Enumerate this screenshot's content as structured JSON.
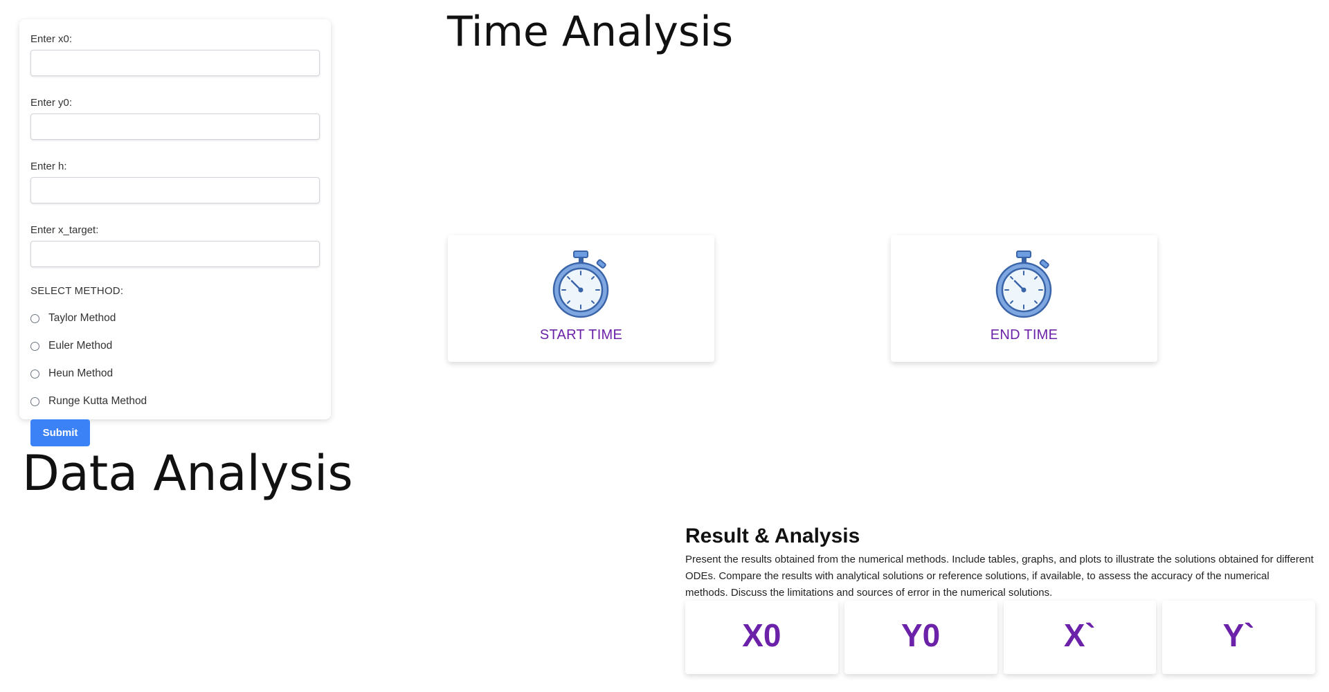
{
  "form": {
    "fields": [
      {
        "label": "Enter x0:",
        "value": "",
        "placeholder": ""
      },
      {
        "label": "Enter y0:",
        "value": "",
        "placeholder": ""
      },
      {
        "label": "Enter h:",
        "value": "",
        "placeholder": ""
      },
      {
        "label": "Enter x_target:",
        "value": "",
        "placeholder": ""
      }
    ],
    "method_heading": "SELECT METHOD:",
    "methods": [
      "Taylor Method",
      "Euler Method",
      "Heun Method",
      "Runge Kutta Method"
    ],
    "submit_label": "Submit"
  },
  "time_analysis": {
    "title": "Time Analysis",
    "start_label": "START TIME",
    "end_label": "END TIME",
    "icon": "stopwatch-icon"
  },
  "data_analysis": {
    "title": "Data Analysis"
  },
  "result": {
    "title": "Result & Analysis",
    "description": "Present the results obtained from the numerical methods. Include tables, graphs, and plots to illustrate the solutions obtained for different ODEs. Compare the results with analytical solutions or reference solutions, if available, to assess the accuracy of the numerical methods. Discuss the limitations and sources of error in the numerical solutions.",
    "cards": [
      "X0",
      "Y0",
      "X`",
      "Y`"
    ]
  },
  "colors": {
    "accent_purple": "#6b21a8",
    "button_blue": "#3b82f6",
    "stopwatch_blue": "#7ea6e0"
  }
}
